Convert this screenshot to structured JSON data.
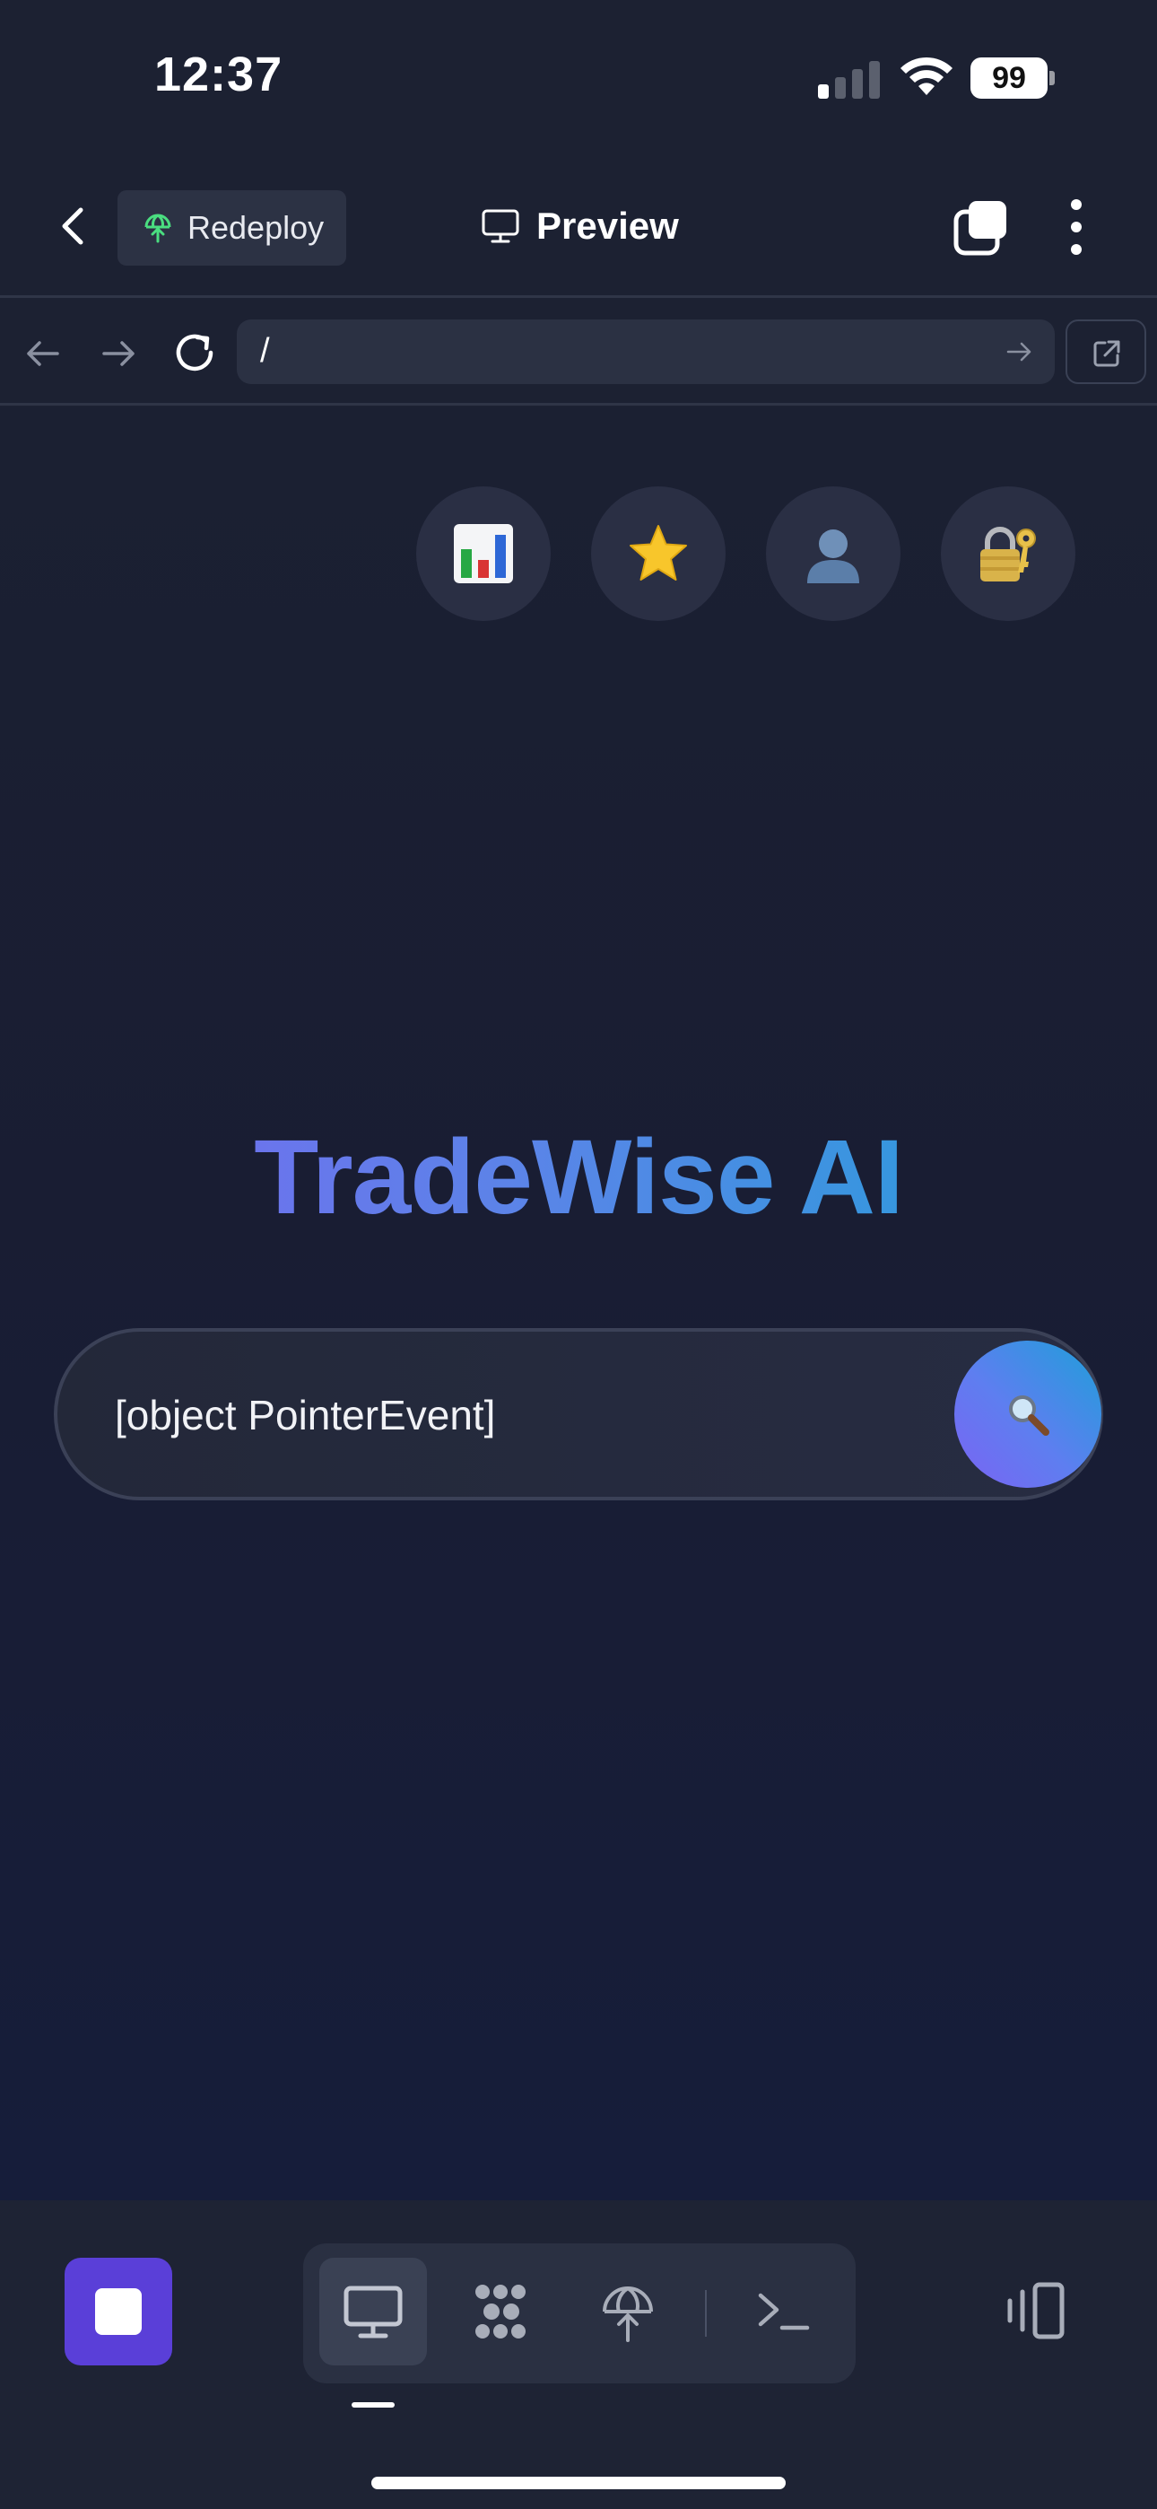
{
  "status_bar": {
    "time": "12:37",
    "battery": "99",
    "signal_bars_active": 1,
    "signal_bars_total": 4
  },
  "header": {
    "back_icon": "chevron-left-icon",
    "redeploy_label": "Redeploy",
    "redeploy_icon": "deploy-globe-icon",
    "title": "Preview",
    "title_icon": "monitor-icon",
    "tabs_icon": "tabs-icon",
    "more_icon": "more-vertical-icon"
  },
  "url_bar": {
    "url": "/",
    "back_icon": "arrow-left-icon",
    "forward_icon": "arrow-right-icon",
    "reload_icon": "reload-icon",
    "go_icon": "arrow-right-icon",
    "open_external_icon": "external-link-icon"
  },
  "page": {
    "quick_icons": [
      {
        "name": "bar-chart-emoji-icon"
      },
      {
        "name": "star-emoji-icon"
      },
      {
        "name": "user-silhouette-emoji-icon"
      },
      {
        "name": "lock-with-key-emoji-icon"
      }
    ],
    "brand_title": "TradeWise AI",
    "search_value": "[object PointerEvent]",
    "search_button_icon": "magnifier-emoji-icon"
  },
  "bottom_bar": {
    "stop_icon": "stop-icon",
    "tools": [
      {
        "name": "preview-tool",
        "icon": "monitor-icon",
        "active": true
      },
      {
        "name": "workspace-tool",
        "icon": "dots-cluster-icon",
        "active": false
      },
      {
        "name": "deploy-tool",
        "icon": "deploy-globe-icon",
        "active": false
      },
      {
        "name": "console-tool",
        "icon": "terminal-icon",
        "active": false
      }
    ],
    "device_icon": "device-rotate-icon"
  },
  "colors": {
    "background": "#1c2132",
    "accent_purple": "#5a3fd8",
    "title_gradient_start": "#7966f0",
    "title_gradient_end": "#1ea3d8",
    "redeploy_icon_green": "#4ade80"
  }
}
